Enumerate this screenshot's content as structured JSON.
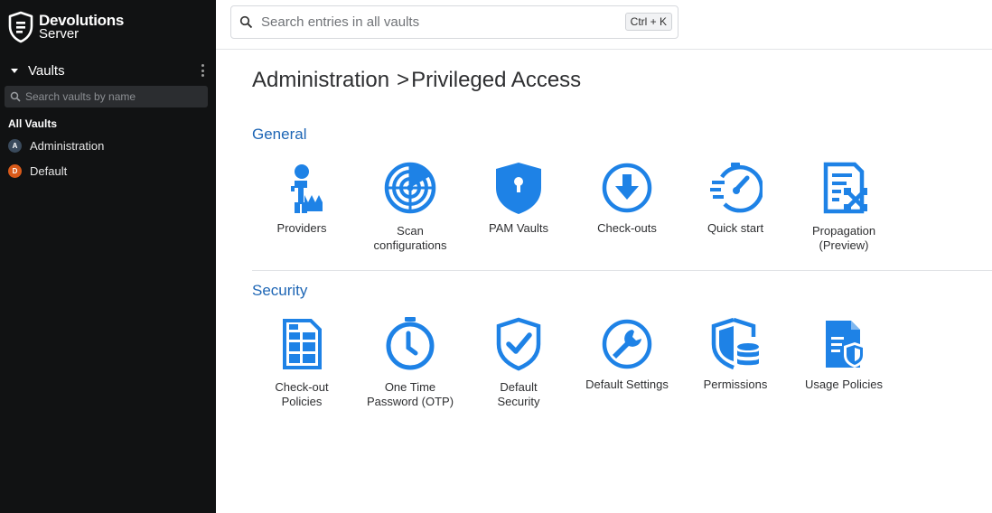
{
  "brand": {
    "line1": "Devolutions",
    "line2": "Server"
  },
  "sidebar": {
    "vaults_title": "Vaults",
    "search_placeholder": "Search vaults by name",
    "all_vaults_label": "All Vaults",
    "items": [
      {
        "badge": "A",
        "label": "Administration",
        "badge_color": "#3a4a5c"
      },
      {
        "badge": "D",
        "label": "Default",
        "badge_color": "#d95a1a"
      }
    ]
  },
  "topbar": {
    "search_placeholder": "Search entries in all vaults",
    "shortcut": "Ctrl + K"
  },
  "breadcrumb": {
    "parent": "Administration",
    "separator": ">",
    "current": "Privileged Access"
  },
  "sections": {
    "general": {
      "title": "General",
      "tiles": [
        {
          "icon": "providers-icon",
          "label": "Providers"
        },
        {
          "icon": "scan-configurations-icon",
          "label": "Scan\nconfigurations"
        },
        {
          "icon": "pam-vaults-icon",
          "label": "PAM Vaults"
        },
        {
          "icon": "check-outs-icon",
          "label": "Check-outs"
        },
        {
          "icon": "quick-start-icon",
          "label": "Quick start"
        },
        {
          "icon": "propagation-icon",
          "label": "Propagation\n(Preview)"
        }
      ]
    },
    "security": {
      "title": "Security",
      "tiles": [
        {
          "icon": "check-out-policies-icon",
          "label": "Check-out\nPolicies"
        },
        {
          "icon": "otp-icon",
          "label": "One Time\nPassword (OTP)"
        },
        {
          "icon": "default-security-icon",
          "label": "Default\nSecurity"
        },
        {
          "icon": "default-settings-icon",
          "label": "Default Settings"
        },
        {
          "icon": "permissions-icon",
          "label": "Permissions"
        },
        {
          "icon": "usage-policies-icon",
          "label": "Usage Policies"
        }
      ]
    }
  },
  "colors": {
    "accent": "#1e82e6",
    "sidebar_bg": "#111213",
    "section_title": "#1e66b5"
  }
}
